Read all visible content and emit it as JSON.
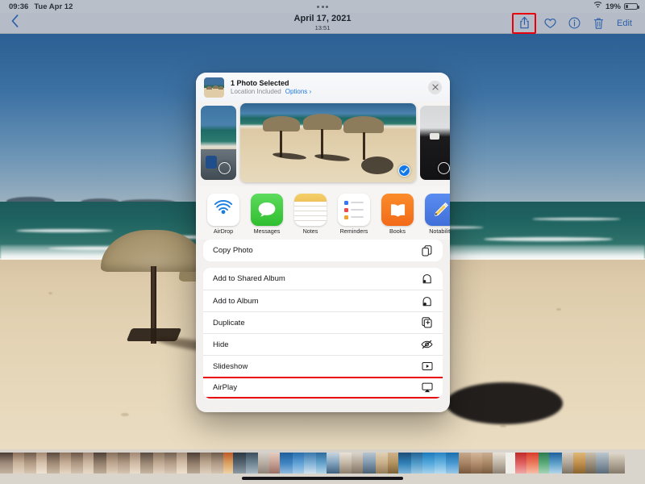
{
  "status_bar": {
    "time": "09:36",
    "date": "Tue Apr 12",
    "battery_percent": "19%",
    "wifi_icon": "wifi-icon",
    "battery_icon": "battery-icon",
    "multitask_dots_icon": "multitask-dots-icon"
  },
  "nav_bar": {
    "back_icon": "back-chevron-icon",
    "title": "April 17, 2021",
    "subtitle": "13:51",
    "actions": {
      "share_icon": "share-icon",
      "favorite_icon": "heart-icon",
      "info_icon": "info-circle-icon",
      "delete_icon": "trash-icon",
      "edit_label": "Edit"
    },
    "highlight_color": "#e8000d"
  },
  "share_sheet": {
    "header": {
      "thumbnail_icon": "photo-thumbnail",
      "title": "1 Photo Selected",
      "location_text": "Location Included",
      "options_label": "Options ›",
      "close_icon": "close-icon"
    },
    "photo_strip": {
      "items": [
        {
          "name": "photo-previous",
          "selected": false
        },
        {
          "name": "photo-current",
          "selected": true
        },
        {
          "name": "photo-next",
          "selected": false
        }
      ],
      "check_icon": "check-icon",
      "selected_color": "#1479e8"
    },
    "apps": [
      {
        "label": "AirDrop",
        "icon": "airdrop-icon"
      },
      {
        "label": "Messages",
        "icon": "messages-icon"
      },
      {
        "label": "Notes",
        "icon": "notes-icon"
      },
      {
        "label": "Reminders",
        "icon": "reminders-icon"
      },
      {
        "label": "Books",
        "icon": "books-icon"
      },
      {
        "label": "Notability",
        "icon": "notability-icon"
      }
    ],
    "actions_group_1": [
      {
        "label": "Copy Photo",
        "icon": "copy-icon",
        "highlighted": false
      }
    ],
    "actions_group_2": [
      {
        "label": "Add to Shared Album",
        "icon": "shared-album-icon",
        "highlighted": false
      },
      {
        "label": "Add to Album",
        "icon": "album-icon",
        "highlighted": false
      },
      {
        "label": "Duplicate",
        "icon": "duplicate-icon",
        "highlighted": false
      },
      {
        "label": "Hide",
        "icon": "hide-eye-icon",
        "highlighted": false
      },
      {
        "label": "Slideshow",
        "icon": "slideshow-icon",
        "highlighted": false
      },
      {
        "label": "AirPlay",
        "icon": "airplay-icon",
        "highlighted": true
      }
    ]
  },
  "background_photo": {
    "description": "beach-photo"
  },
  "filmstrip": {
    "name": "photo-filmstrip",
    "home_indicator": "home-indicator"
  }
}
